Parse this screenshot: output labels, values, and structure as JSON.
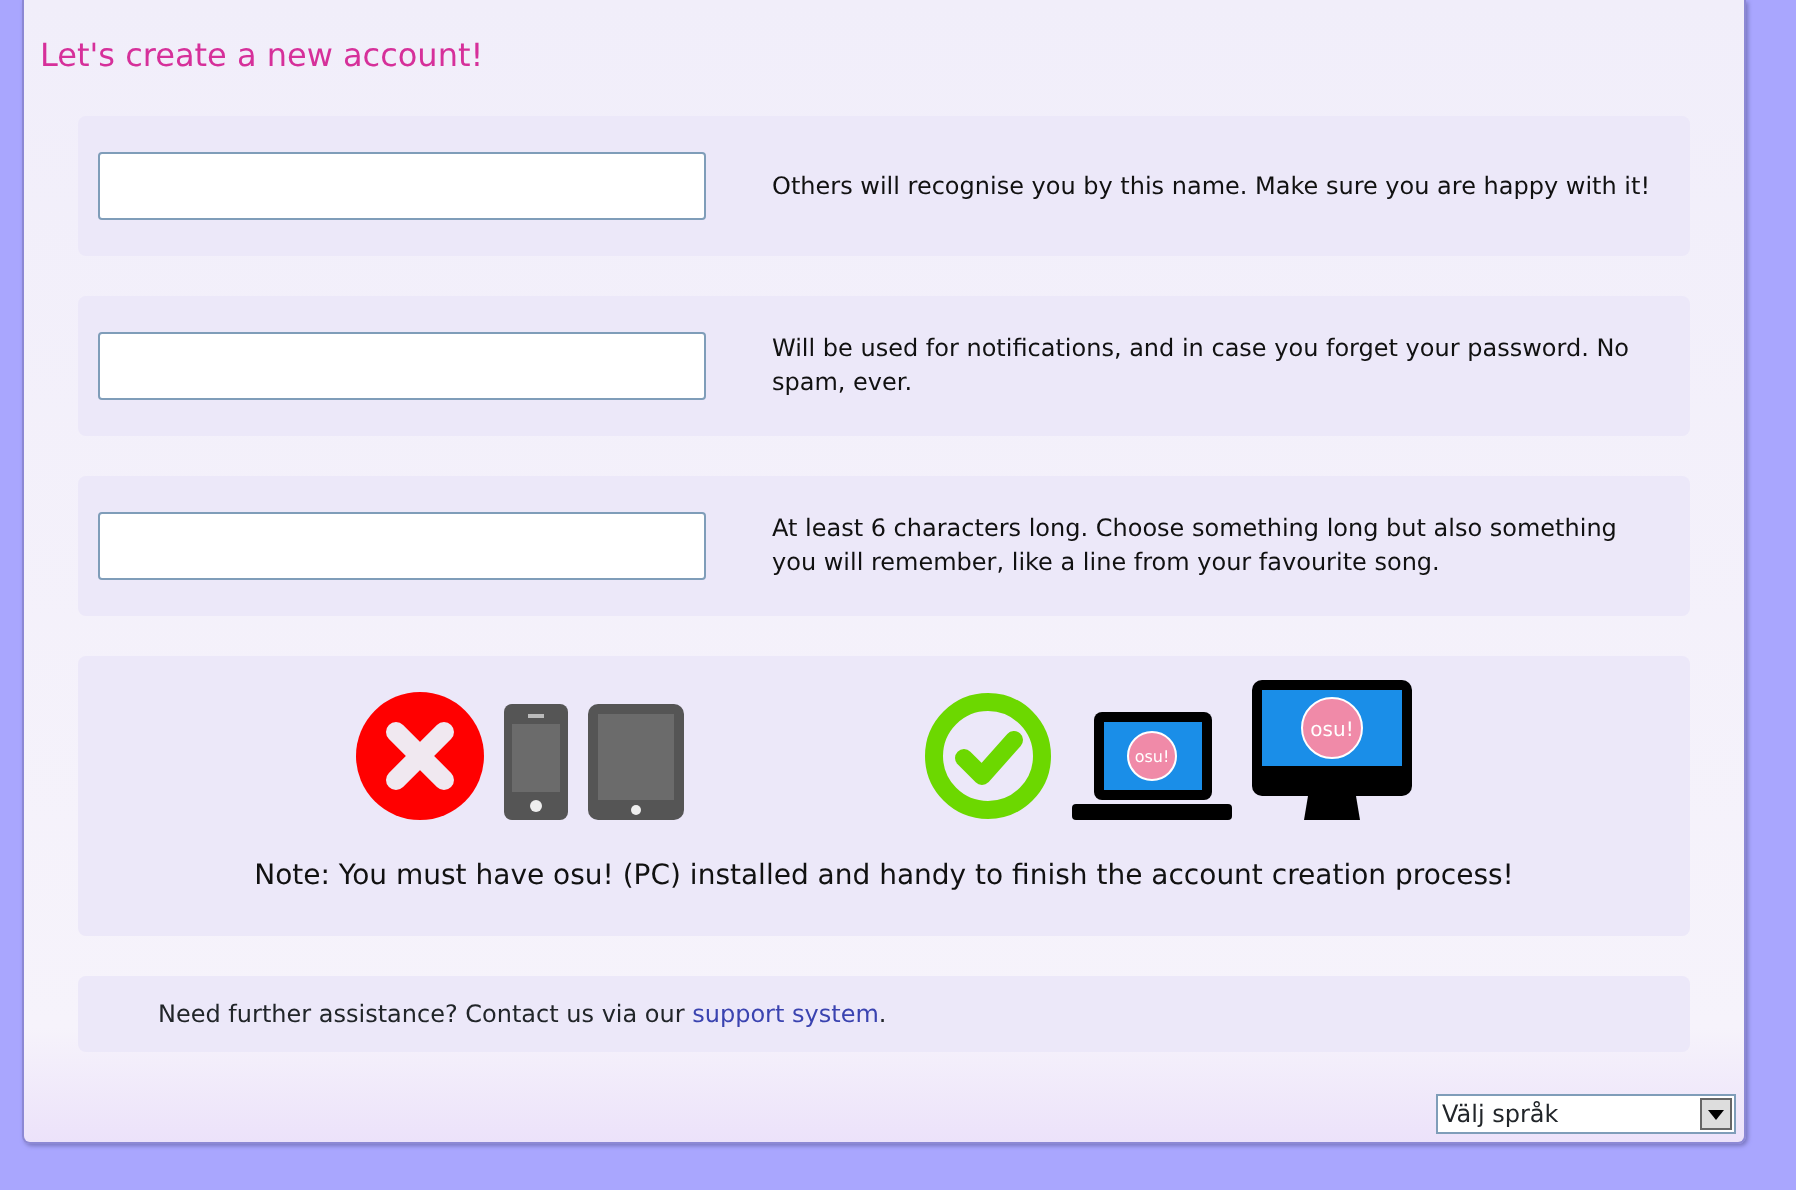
{
  "title": "Let's create a new account!",
  "fields": [
    {
      "hint": "Others will recognise you by this name. Make sure you are happy with it!"
    },
    {
      "hint": "Will be used for notifications, and in case you forget your password. No spam, ever."
    },
    {
      "hint": "At least 6 characters long. Choose something long but also something you will remember, like a line from your favourite song."
    }
  ],
  "devices": [
    {
      "kind": "cross"
    },
    {
      "kind": "phone"
    },
    {
      "kind": "tablet"
    },
    {
      "kind": "gap"
    },
    {
      "kind": "check"
    },
    {
      "kind": "laptop",
      "label": "osu!"
    },
    {
      "kind": "monitor",
      "label": "osu!"
    }
  ],
  "note": "Note: You must have osu! (PC) installed and handy to finish the account creation process!",
  "help": {
    "text": "Need further assistance? Contact us via our ",
    "link": "support system",
    "after": "."
  },
  "language": {
    "value": "Välj språk"
  }
}
